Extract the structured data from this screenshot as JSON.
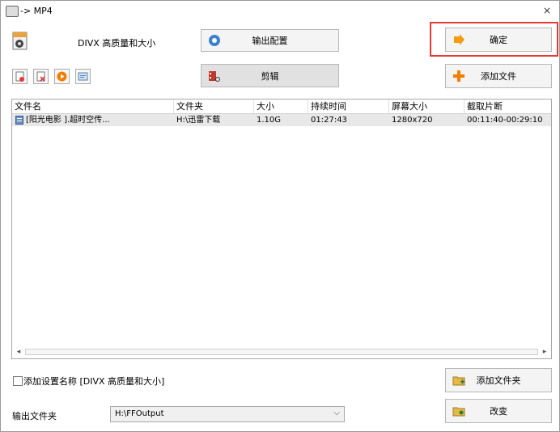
{
  "window": {
    "title": "-> MP4",
    "close_glyph": "×"
  },
  "profile": {
    "label": "DIVX 高质量和大小",
    "icon": "divx-file-icon"
  },
  "buttons": {
    "output_config": "输出配置",
    "edit": "剪辑",
    "confirm": "确定",
    "add_file": "添加文件",
    "add_folder": "添加文件夹",
    "change": "改变"
  },
  "toolbar_icons": [
    "remove-file-icon",
    "clear-list-icon",
    "play-icon",
    "media-info-icon"
  ],
  "file_list": {
    "columns": [
      "文件名",
      "文件夹",
      "大小",
      "持续时间",
      "屏幕大小",
      "截取片断"
    ],
    "rows": [
      {
        "name": "[阳光电影              ].超时空传...",
        "folder": "H:\\迅雷下载",
        "size": "1.10G",
        "duration": "01:27:43",
        "screen": "1280x720",
        "clip": "00:11:40-00:29:10"
      }
    ]
  },
  "add_setting_name": {
    "label": "添加设置名称 [DIVX 高质量和大小]",
    "checked": false
  },
  "output_folder": {
    "label": "输出文件夹",
    "value": "H:\\FFOutput"
  },
  "colors": {
    "highlight": "#e53935",
    "accent": "#f57c00"
  }
}
